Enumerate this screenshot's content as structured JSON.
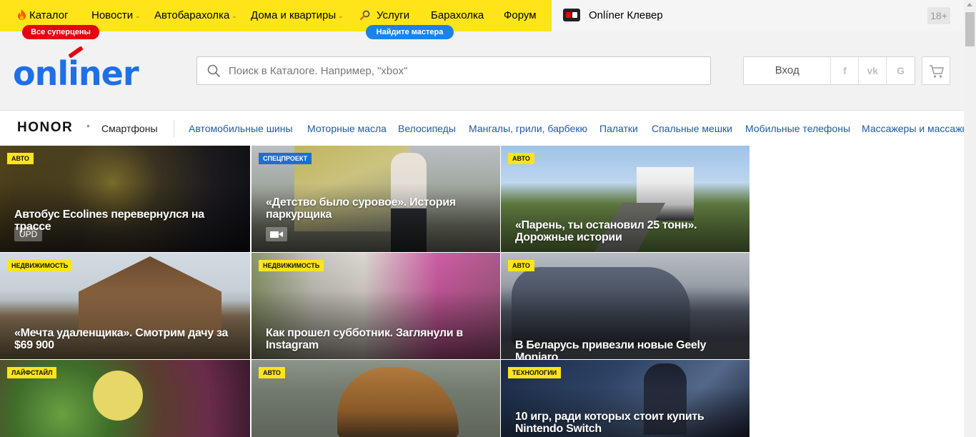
{
  "topbar": {
    "nav": [
      {
        "label": "Каталог",
        "icon": "flame-icon",
        "chevron": false
      },
      {
        "label": "Новости",
        "chevron": true
      },
      {
        "label": "Автобарахолка",
        "chevron": true
      },
      {
        "label": "Дома и квартиры",
        "chevron": true
      },
      {
        "label": "Услуги",
        "icon": "magnifier-icon",
        "chevron": false
      },
      {
        "label": "Барахолка",
        "chevron": false
      },
      {
        "label": "Форум",
        "chevron": false
      }
    ],
    "catalog_badge": "Все суперцены",
    "services_badge": "Найдите мастера",
    "klever_label": "Onlíner Клевер",
    "age_label": "18+",
    "colors": {
      "yellow": "#ffe419",
      "red": "#e8000e",
      "blue": "#1a82ea"
    }
  },
  "header": {
    "logo_text": "onliner",
    "search_placeholder": "Поиск в Каталоге. Например, \"xbox\"",
    "login_label": "Вход",
    "social": [
      {
        "label": "f",
        "icon": "facebook-icon"
      },
      {
        "label": "vk",
        "icon": "vk-icon"
      },
      {
        "label": "G",
        "icon": "google-icon"
      }
    ],
    "cart_icon": "cart-icon"
  },
  "strip": {
    "brand": "HONOR",
    "dot": "•",
    "category": "Смартфоны",
    "links": [
      "Автомобильные шины",
      "Моторные масла",
      "Велосипеды",
      "Мангалы, грили, барбекю",
      "Палатки",
      "Спальные мешки",
      "Мобильные телефоны",
      "Массажеры и массажные"
    ]
  },
  "news": [
    {
      "tag": "Авто",
      "tag_style": "yellow",
      "title": "Автобус Ecolines перевернулся на трассе",
      "extra": "UPD"
    },
    {
      "tag": "Спецпроект",
      "tag_style": "blue",
      "title": "«Детство было суровое». История паркурщика",
      "extra": "video"
    },
    {
      "tag": "Авто",
      "tag_style": "yellow",
      "title": "«Парень, ты остановил 25 тонн». Дорожные истории",
      "extra": ""
    },
    {
      "tag": "Недвижимость",
      "tag_style": "yellow",
      "title": "«Мечта удаленщика». Смотрим дачу за $69 900",
      "extra": ""
    },
    {
      "tag": "Недвижимость",
      "tag_style": "yellow",
      "title": "Как прошел субботник. Заглянули в Instagram",
      "extra": ""
    },
    {
      "tag": "Авто",
      "tag_style": "yellow",
      "title": "В Беларусь привезли новые Geely Monjaro",
      "extra": ""
    },
    {
      "tag": "Лайфстайл",
      "tag_style": "yellow",
      "title": "",
      "extra": ""
    },
    {
      "tag": "Авто",
      "tag_style": "yellow",
      "title": "",
      "extra": ""
    },
    {
      "tag": "Технологии",
      "tag_style": "yellow",
      "title": "10 игр, ради которых стоит купить Nintendo Switch",
      "extra": ""
    }
  ]
}
